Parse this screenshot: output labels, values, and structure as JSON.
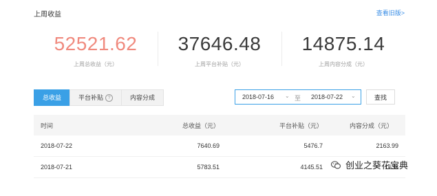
{
  "header": {
    "title": "上周收益",
    "old_version_link": "查看旧版>"
  },
  "stats": [
    {
      "value": "52521.62",
      "label": "上周总收益（元）"
    },
    {
      "value": "37646.48",
      "label": "上周平台补贴（元）"
    },
    {
      "value": "14875.14",
      "label": "上周内容分成（元）"
    }
  ],
  "tabs": [
    {
      "label": "总收益"
    },
    {
      "label": "平台补贴"
    },
    {
      "label": "内容分成"
    }
  ],
  "help_icon_text": "?",
  "date_range": {
    "start": "2018-07-16",
    "separator": "至",
    "end": "2018-07-22",
    "chevron": "⌄"
  },
  "search_button": "查找",
  "table": {
    "headers": {
      "time": "时间",
      "total": "总收益（元）",
      "subsidy": "平台补贴（元）",
      "share": "内容分成（元）"
    },
    "rows": [
      {
        "time": "2018-07-22",
        "total": "7640.69",
        "subsidy": "5476.7",
        "share": "2163.99"
      },
      {
        "time": "2018-07-21",
        "total": "5783.51",
        "subsidy": "4145.51",
        "share": "1638"
      }
    ]
  },
  "watermark": {
    "text": "创业之葵花宝典"
  }
}
